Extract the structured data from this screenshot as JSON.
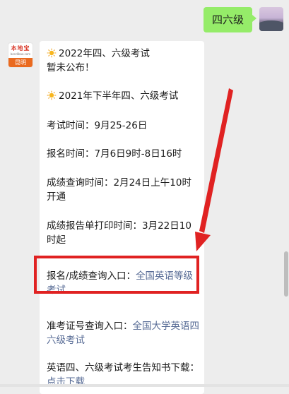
{
  "outgoing_message": {
    "text": "四六级"
  },
  "bot_avatar": {
    "logo_text": "本地宝",
    "domain_text": "bendibao.com",
    "city_label": "昆明"
  },
  "incoming_message": {
    "blocks": [
      {
        "lines": [
          "2022年四、六级考试",
          "暂未公布！"
        ]
      },
      {
        "lines": [
          "2021年下半年四、六级考试"
        ]
      },
      {
        "lines": [
          "考试时间：9月25-26日"
        ]
      },
      {
        "lines": [
          "报名时间：7月6日9时-8日16时"
        ]
      },
      {
        "lines": [
          "成绩查询时间：2月24日上午10时",
          "开通"
        ]
      },
      {
        "lines": [
          "成绩报告单打印时间：3月22日10",
          "时起"
        ]
      },
      {
        "prefix": "报名/成绩查询入口：",
        "link": "全国英语等级考试"
      },
      {
        "prefix": "准考证号查询入口：",
        "link": "全国大学英语四六级考试"
      },
      {
        "prefix": "英语四、六级考试考生告知书下载：",
        "link": "点击下载"
      }
    ]
  },
  "colors": {
    "outgoing_bubble": "#95ec69",
    "link": "#576b95",
    "highlight": "#e02222",
    "background": "#ededed"
  }
}
